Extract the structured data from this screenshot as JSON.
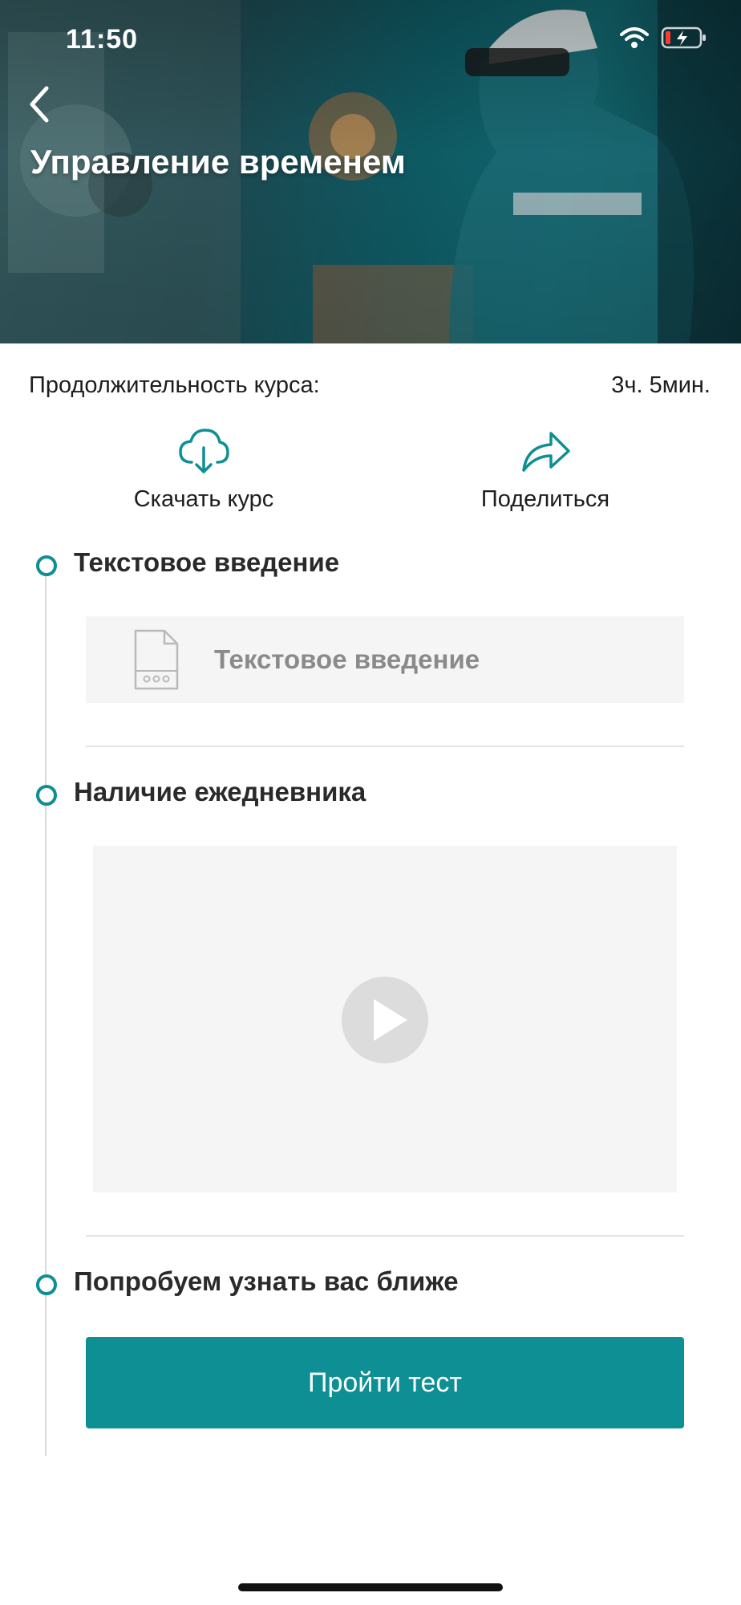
{
  "status_bar": {
    "time": "11:50"
  },
  "header": {
    "title": "Управление временем"
  },
  "course_info": {
    "duration_label": "Продолжительность курса:",
    "duration_value": "3ч. 5мин."
  },
  "actions": {
    "download_label": "Скачать курс",
    "share_label": "Поделиться"
  },
  "sections": [
    {
      "title": "Текстовое введение",
      "card_label": "Текстовое введение"
    },
    {
      "title": "Наличие ежедневника"
    },
    {
      "title": "Попробуем узнать вас ближе",
      "button_label": "Пройти тест"
    }
  ],
  "colors": {
    "accent": "#0e8f94",
    "card_bg": "#f5f5f5",
    "timeline": "#d9d9d9"
  },
  "icons": [
    "back-icon",
    "wifi-icon",
    "battery-icon",
    "cloud-download-icon",
    "share-icon",
    "document-icon",
    "play-icon"
  ]
}
